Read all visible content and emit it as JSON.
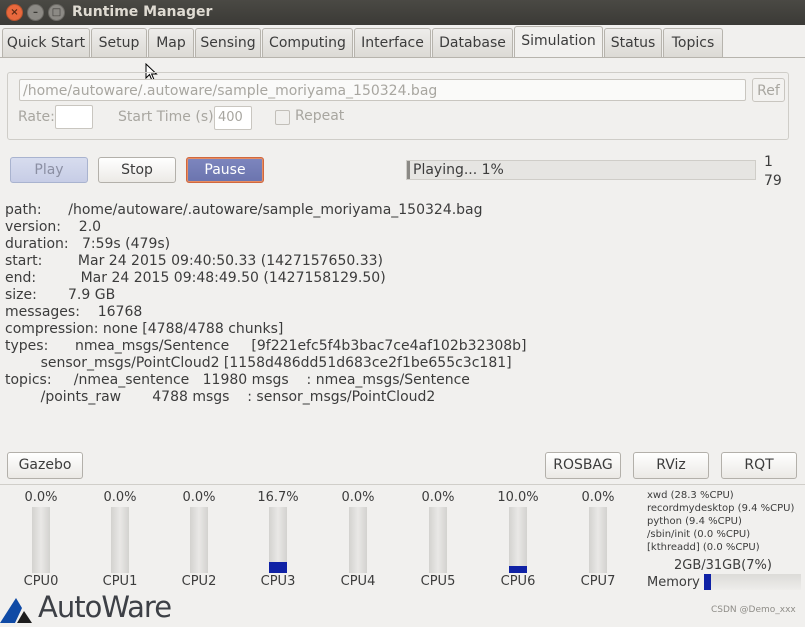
{
  "window": {
    "title": "Runtime Manager",
    "controls": [
      "close-icon",
      "minimize-icon",
      "maximize-icon"
    ]
  },
  "tabs": [
    {
      "label": "Quick Start",
      "active": false
    },
    {
      "label": "Setup",
      "active": false
    },
    {
      "label": "Map",
      "active": false
    },
    {
      "label": "Sensing",
      "active": false
    },
    {
      "label": "Computing",
      "active": false
    },
    {
      "label": "Interface",
      "active": false
    },
    {
      "label": "Database",
      "active": false
    },
    {
      "label": "Simulation",
      "active": true
    },
    {
      "label": "Status",
      "active": false
    },
    {
      "label": "Topics",
      "active": false
    }
  ],
  "bag": {
    "path_value": "/home/autoware/.autoware/sample_moriyama_150324.bag",
    "ref_label": "Ref",
    "rate_label": "Rate:",
    "rate_value": "",
    "start_time_label": "Start Time (s):",
    "start_time_value": "400",
    "repeat_label": "Repeat",
    "repeat_checked": false
  },
  "controls": {
    "play_label": "Play",
    "stop_label": "Stop",
    "pause_label": "Pause",
    "progress_text": "Playing...  1%",
    "progress_fraction": 0.01,
    "counter_top": "1",
    "counter_bottom": "79"
  },
  "info": {
    "path": "path:      /home/autoware/.autoware/sample_moriyama_150324.bag",
    "version": "version:    2.0",
    "duration": "duration:   7:59s (479s)",
    "start": "start:        Mar 24 2015 09:40:50.33 (1427157650.33)",
    "end": "end:          Mar 24 2015 09:48:49.50 (1427158129.50)",
    "size": "size:       7.9 GB",
    "messages": "messages:    16768",
    "compression": "compression: none [4788/4788 chunks]",
    "types_1": "types:      nmea_msgs/Sentence     [9f221efc5f4b3bac7ce4af102b32308b]",
    "types_2": "        sensor_msgs/PointCloud2 [1158d486dd51d683ce2f1be655c3c181]",
    "topics_1": "topics:     /nmea_sentence   11980 msgs    : nmea_msgs/Sentence",
    "topics_2": "        /points_raw       4788 msgs    : sensor_msgs/PointCloud2"
  },
  "tools": {
    "gazebo_label": "Gazebo",
    "rosbag_label": "ROSBAG",
    "rviz_label": "RViz",
    "rqt_label": "RQT"
  },
  "cpus": [
    {
      "name": "CPU0",
      "percent_text": "0.0%",
      "value": 0.0
    },
    {
      "name": "CPU1",
      "percent_text": "0.0%",
      "value": 0.0
    },
    {
      "name": "CPU2",
      "percent_text": "0.0%",
      "value": 0.0
    },
    {
      "name": "CPU3",
      "percent_text": "16.7%",
      "value": 16.7
    },
    {
      "name": "CPU4",
      "percent_text": "0.0%",
      "value": 0.0
    },
    {
      "name": "CPU5",
      "percent_text": "0.0%",
      "value": 0.0
    },
    {
      "name": "CPU6",
      "percent_text": "10.0%",
      "value": 10.0
    },
    {
      "name": "CPU7",
      "percent_text": "0.0%",
      "value": 0.0
    }
  ],
  "processes": [
    "xwd (28.3 %CPU)",
    "recordmydesktop (9.4 %CPU)",
    "python (9.4 %CPU)",
    "/sbin/init (0.0 %CPU)",
    "[kthreadd] (0.0 %CPU)"
  ],
  "memory": {
    "label": "Memory",
    "usage_text": "2GB/31GB(7%)",
    "fraction": 0.07
  },
  "brand": {
    "logo_text": "AutoWare",
    "watermark": "CSDN @Demo_xxx"
  },
  "colors": {
    "meter_fill": "#0f21a5",
    "pause_button": "#7079b4",
    "close_button": "#e8683d"
  }
}
